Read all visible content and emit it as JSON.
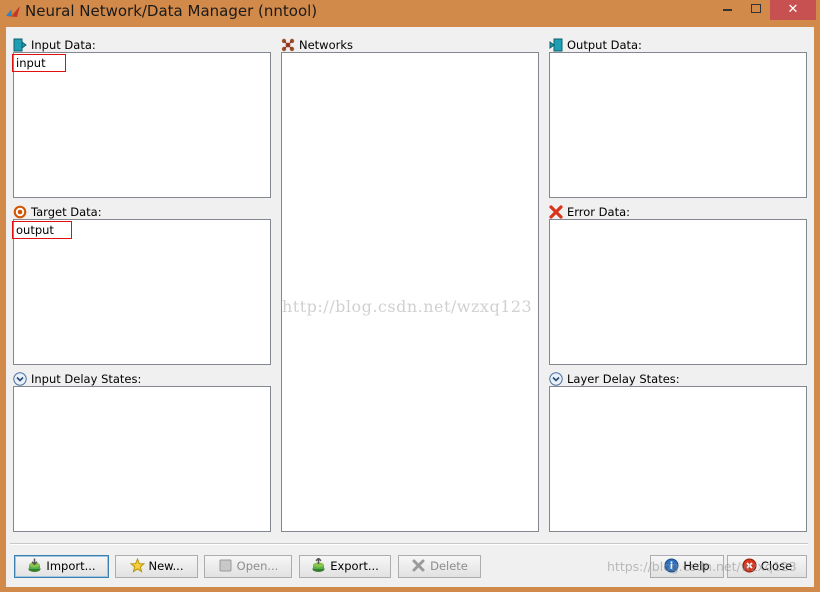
{
  "window": {
    "title": "Neural Network/Data Manager (nntool)",
    "close_glyph": "✕"
  },
  "sections": {
    "input_data": {
      "label": "Input Data:",
      "icon": "input-data-icon",
      "items": [
        "input"
      ]
    },
    "networks": {
      "label": "Networks",
      "icon": "network-icon",
      "items": []
    },
    "output_data": {
      "label": "Output Data:",
      "icon": "output-data-icon",
      "items": []
    },
    "target_data": {
      "label": "Target Data:",
      "icon": "target-icon",
      "items": [
        "output"
      ]
    },
    "error_data": {
      "label": "Error Data:",
      "icon": "error-x-icon",
      "items": []
    },
    "input_delay_states": {
      "label": "Input Delay States:",
      "icon": "chevron-down-circle-icon",
      "items": []
    },
    "layer_delay_states": {
      "label": "Layer Delay States:",
      "icon": "chevron-down-circle-icon",
      "items": []
    }
  },
  "buttons": {
    "import": "Import...",
    "new": "New...",
    "open": "Open...",
    "export": "Export...",
    "delete": "Delete",
    "help": "Help",
    "close": "Close"
  },
  "watermark": {
    "center": "http://blog.csdn.net/wzxq123",
    "corner": "https://blog.csdn.net/wzxq123"
  },
  "colors": {
    "title_bar": "#d28a4a",
    "client_bg": "#f0f0f0",
    "selection_border": "#e01010",
    "close_button": "#c75050"
  }
}
